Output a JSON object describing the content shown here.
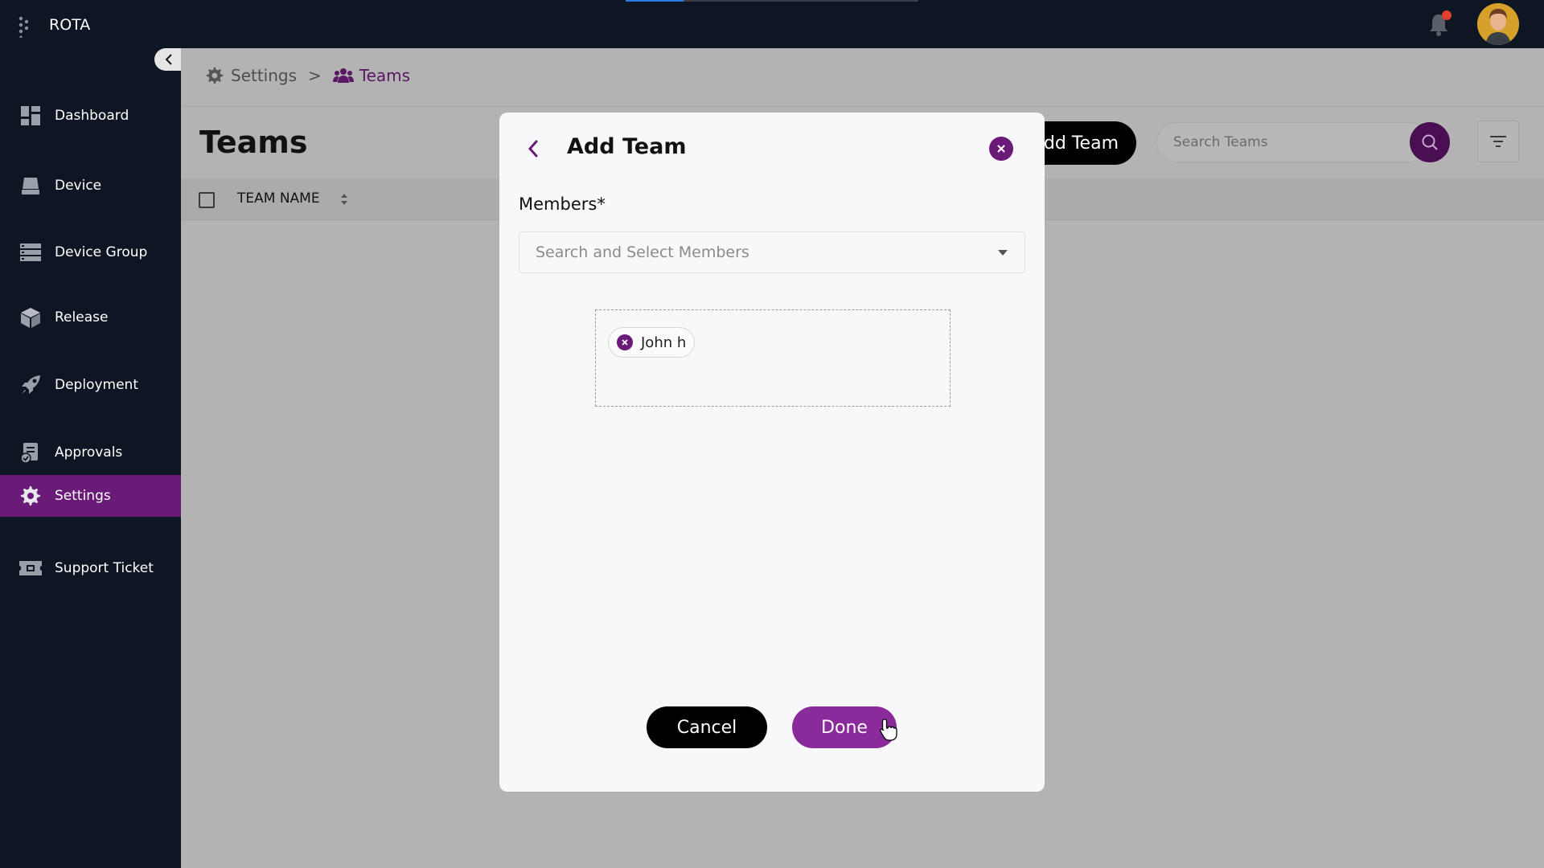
{
  "app": {
    "title": "ROTA"
  },
  "sidebar": {
    "items": [
      {
        "label": "Dashboard",
        "icon": "dashboard-icon"
      },
      {
        "label": "Device",
        "icon": "device-icon"
      },
      {
        "label": "Device Group",
        "icon": "device-group-icon"
      },
      {
        "label": "Release",
        "icon": "release-box-icon"
      },
      {
        "label": "Deployment",
        "icon": "rocket-icon"
      },
      {
        "label": "Approvals",
        "icon": "approvals-icon"
      },
      {
        "label": "Settings",
        "icon": "gear-icon",
        "active": true
      },
      {
        "label": "Support Ticket",
        "icon": "ticket-icon"
      }
    ]
  },
  "breadcrumb": {
    "root": "Settings",
    "separator": ">",
    "current": "Teams"
  },
  "page": {
    "title": "Teams",
    "add_button": "Add Team",
    "search_placeholder": "Search Teams"
  },
  "table": {
    "columns": [
      "TEAM NAME"
    ]
  },
  "modal": {
    "title": "Add Team",
    "members_label": "Members*",
    "members_placeholder": "Search and Select Members",
    "selected_members": [
      "John h"
    ],
    "cancel_label": "Cancel",
    "done_label": "Done"
  },
  "colors": {
    "brand": "#6a1b78",
    "sidebar_bg": "#0f1623",
    "done_button": "#8b2a9b"
  }
}
